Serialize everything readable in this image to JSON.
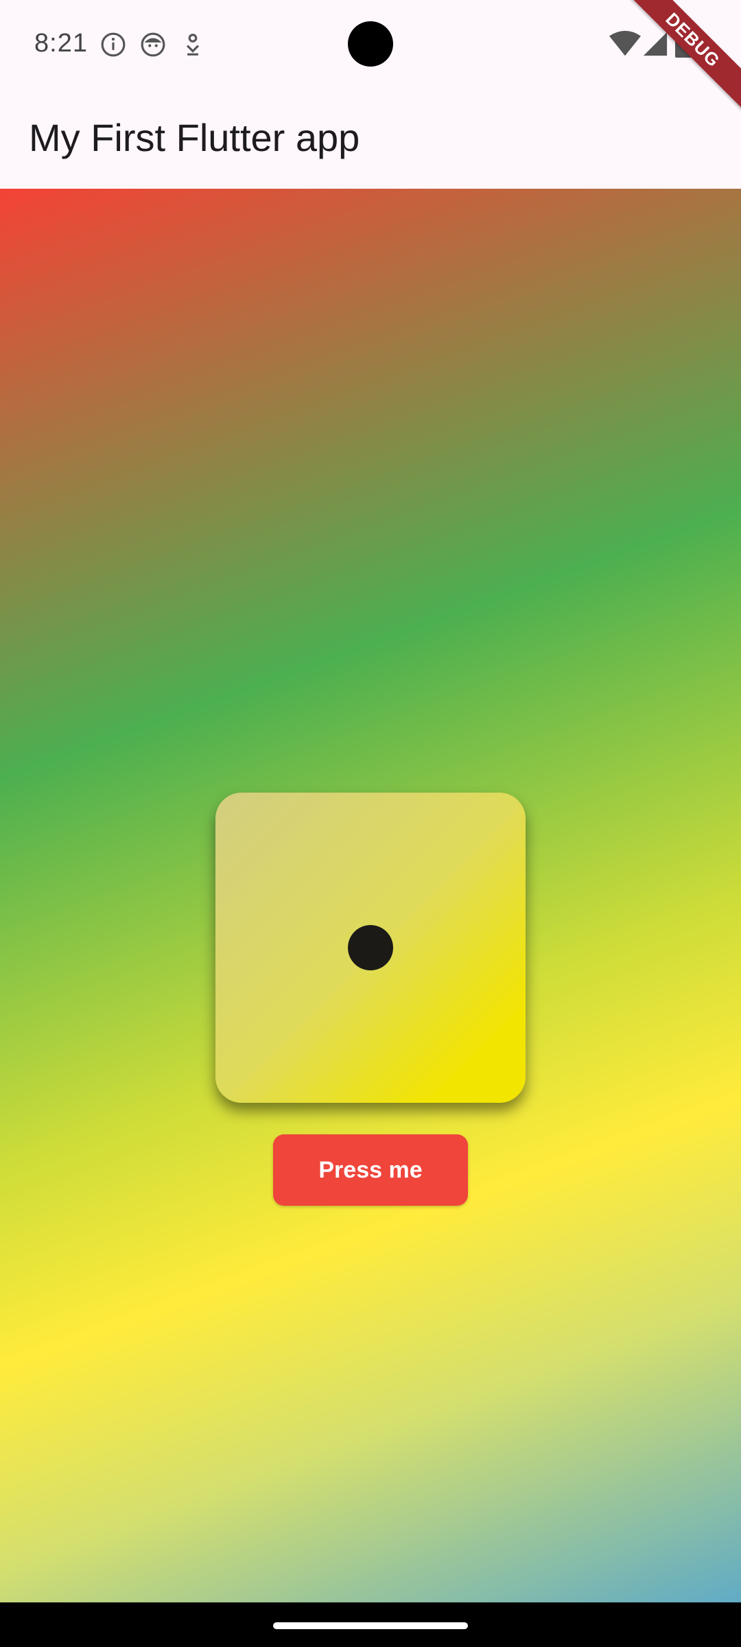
{
  "status_bar": {
    "time": "8:21",
    "left_icons": [
      "info-icon",
      "face-icon",
      "download-icon"
    ],
    "right_icons": [
      "wifi-icon",
      "signal-icon",
      "battery-icon"
    ]
  },
  "debug_banner": "DEBUG",
  "app_bar": {
    "title": "My First Flutter app"
  },
  "background": {
    "gradient_colors": [
      "#f44336",
      "#4caf50",
      "#cddc39",
      "#ffeb3b",
      "#60abc6"
    ]
  },
  "dice": {
    "value": 1,
    "face_color": "#f2e500",
    "pip_color": "#1b1a17"
  },
  "button": {
    "label": "Press me",
    "color": "#ef453b"
  }
}
